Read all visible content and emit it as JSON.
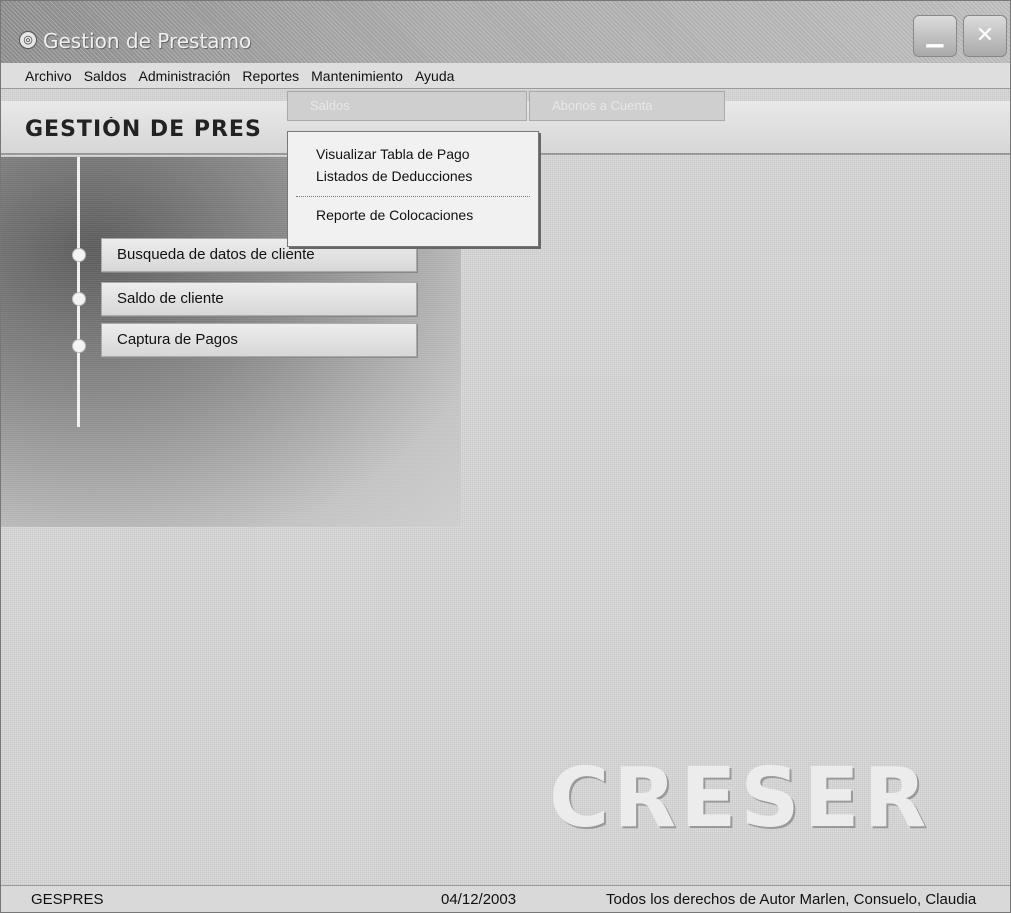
{
  "window": {
    "title": "Gestion de Prestamo",
    "icon": "app-globe-icon",
    "controls": [
      "minimize-icon",
      "close-icon"
    ]
  },
  "menubar": {
    "items": [
      "Archivo",
      "Saldos",
      "Administración",
      "Reportes",
      "Mantenimiento",
      "Ayuda"
    ]
  },
  "toolbar": {
    "ghost_buttons": [
      "Saldos",
      "Abonos a Cuenta"
    ]
  },
  "header": {
    "title": "GESTIÓN DE PRES"
  },
  "reportes_menu": {
    "items": [
      "Visualizar Tabla de Pago",
      "Listados de Deducciones",
      "Reporte de Colocaciones"
    ]
  },
  "nav": {
    "items": [
      "Busqueda de datos de cliente",
      "Saldo de cliente",
      "Captura de Pagos"
    ]
  },
  "logo": {
    "text": "CRESER"
  },
  "statusbar": {
    "app": "GESPRES",
    "date": "04/12/2003",
    "copyright": "Todos los derechos de Autor Marlen, Consuelo, Claudia"
  }
}
